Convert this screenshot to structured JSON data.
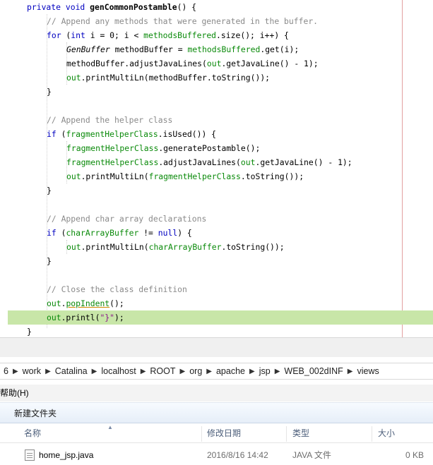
{
  "editor": {
    "lines": [
      {
        "indent": 38,
        "tokens": [
          {
            "t": "private void ",
            "c": "kw"
          },
          {
            "t": "genCommonPostamble",
            "c": "mth"
          },
          {
            "t": "() {",
            "c": ""
          }
        ]
      },
      {
        "indent": 66,
        "tokens": [
          {
            "t": "// Append any methods that were generated in the buffer.",
            "c": "cmt"
          }
        ]
      },
      {
        "indent": 66,
        "tokens": [
          {
            "t": "for",
            "c": "kw"
          },
          {
            "t": " (",
            "c": ""
          },
          {
            "t": "int",
            "c": "kw"
          },
          {
            "t": " i = 0; i < ",
            "c": ""
          },
          {
            "t": "methodsBuffered",
            "c": "fld"
          },
          {
            "t": ".size(); i++) {",
            "c": ""
          }
        ]
      },
      {
        "indent": 94,
        "tokens": [
          {
            "t": "GenBuffer",
            "c": "typ"
          },
          {
            "t": " methodBuffer = ",
            "c": ""
          },
          {
            "t": "methodsBuffered",
            "c": "fld"
          },
          {
            "t": ".get(i);",
            "c": ""
          }
        ]
      },
      {
        "indent": 94,
        "tokens": [
          {
            "t": "methodBuffer.adjustJavaLines(",
            "c": ""
          },
          {
            "t": "out",
            "c": "fld"
          },
          {
            "t": ".getJavaLine() - 1);",
            "c": ""
          }
        ]
      },
      {
        "indent": 94,
        "tokens": [
          {
            "t": "out",
            "c": "fld"
          },
          {
            "t": ".printMultiLn(methodBuffer.toString());",
            "c": ""
          }
        ]
      },
      {
        "indent": 66,
        "tokens": [
          {
            "t": "}",
            "c": ""
          }
        ]
      },
      {
        "indent": 66,
        "tokens": []
      },
      {
        "indent": 66,
        "tokens": [
          {
            "t": "// Append the helper class",
            "c": "cmt"
          }
        ]
      },
      {
        "indent": 66,
        "tokens": [
          {
            "t": "if",
            "c": "kw"
          },
          {
            "t": " (",
            "c": ""
          },
          {
            "t": "fragmentHelperClass",
            "c": "fld"
          },
          {
            "t": ".isUsed()) {",
            "c": ""
          }
        ]
      },
      {
        "indent": 94,
        "tokens": [
          {
            "t": "fragmentHelperClass",
            "c": "fld"
          },
          {
            "t": ".generatePostamble();",
            "c": ""
          }
        ]
      },
      {
        "indent": 94,
        "tokens": [
          {
            "t": "fragmentHelperClass",
            "c": "fld"
          },
          {
            "t": ".adjustJavaLines(",
            "c": ""
          },
          {
            "t": "out",
            "c": "fld"
          },
          {
            "t": ".getJavaLine() - 1);",
            "c": ""
          }
        ]
      },
      {
        "indent": 94,
        "tokens": [
          {
            "t": "out",
            "c": "fld"
          },
          {
            "t": ".printMultiLn(",
            "c": ""
          },
          {
            "t": "fragmentHelperClass",
            "c": "fld"
          },
          {
            "t": ".toString());",
            "c": ""
          }
        ]
      },
      {
        "indent": 66,
        "tokens": [
          {
            "t": "}",
            "c": ""
          }
        ]
      },
      {
        "indent": 66,
        "tokens": []
      },
      {
        "indent": 66,
        "tokens": [
          {
            "t": "// Append char array declarations",
            "c": "cmt"
          }
        ]
      },
      {
        "indent": 66,
        "tokens": [
          {
            "t": "if",
            "c": "kw"
          },
          {
            "t": " (",
            "c": ""
          },
          {
            "t": "charArrayBuffer",
            "c": "fld"
          },
          {
            "t": " != ",
            "c": ""
          },
          {
            "t": "null",
            "c": "kw"
          },
          {
            "t": ") {",
            "c": ""
          }
        ]
      },
      {
        "indent": 94,
        "tokens": [
          {
            "t": "out",
            "c": "fld"
          },
          {
            "t": ".printMultiLn(",
            "c": ""
          },
          {
            "t": "charArrayBuffer",
            "c": "fld"
          },
          {
            "t": ".toString());",
            "c": ""
          }
        ]
      },
      {
        "indent": 66,
        "tokens": [
          {
            "t": "}",
            "c": ""
          }
        ]
      },
      {
        "indent": 66,
        "tokens": []
      },
      {
        "indent": 66,
        "tokens": [
          {
            "t": "// Close the class definition",
            "c": "cmt"
          }
        ]
      },
      {
        "indent": 66,
        "tokens": [
          {
            "t": "out",
            "c": "fld"
          },
          {
            "t": ".",
            "c": ""
          },
          {
            "t": "popIndent",
            "c": "warn"
          },
          {
            "t": "();",
            "c": ""
          }
        ]
      },
      {
        "indent": 66,
        "highlight": true,
        "tokens": [
          {
            "t": "out",
            "c": "fld"
          },
          {
            "t": ".print",
            "c": ""
          },
          {
            "t": "l",
            "c": ""
          },
          {
            "t": "(",
            "c": ""
          },
          {
            "t": "\"}\"",
            "c": "str"
          },
          {
            "t": ");",
            "c": ""
          }
        ]
      },
      {
        "indent": 38,
        "tokens": [
          {
            "t": "}",
            "c": ""
          }
        ]
      }
    ]
  },
  "address_bar": {
    "segments": [
      "6",
      "work",
      "Catalina",
      "localhost",
      "ROOT",
      "org",
      "apache",
      "jsp",
      "WEB_002dINF",
      "views"
    ]
  },
  "menu": {
    "help_label": "帮助(H)"
  },
  "toolbar": {
    "new_folder_label": "新建文件夹"
  },
  "file_list": {
    "columns": {
      "name": "名称",
      "modified": "修改日期",
      "type": "类型",
      "size": "大小"
    },
    "rows": [
      {
        "name": "home_jsp.java",
        "modified": "2016/8/16 14:42",
        "type": "JAVA 文件",
        "size": "0 KB"
      }
    ]
  }
}
